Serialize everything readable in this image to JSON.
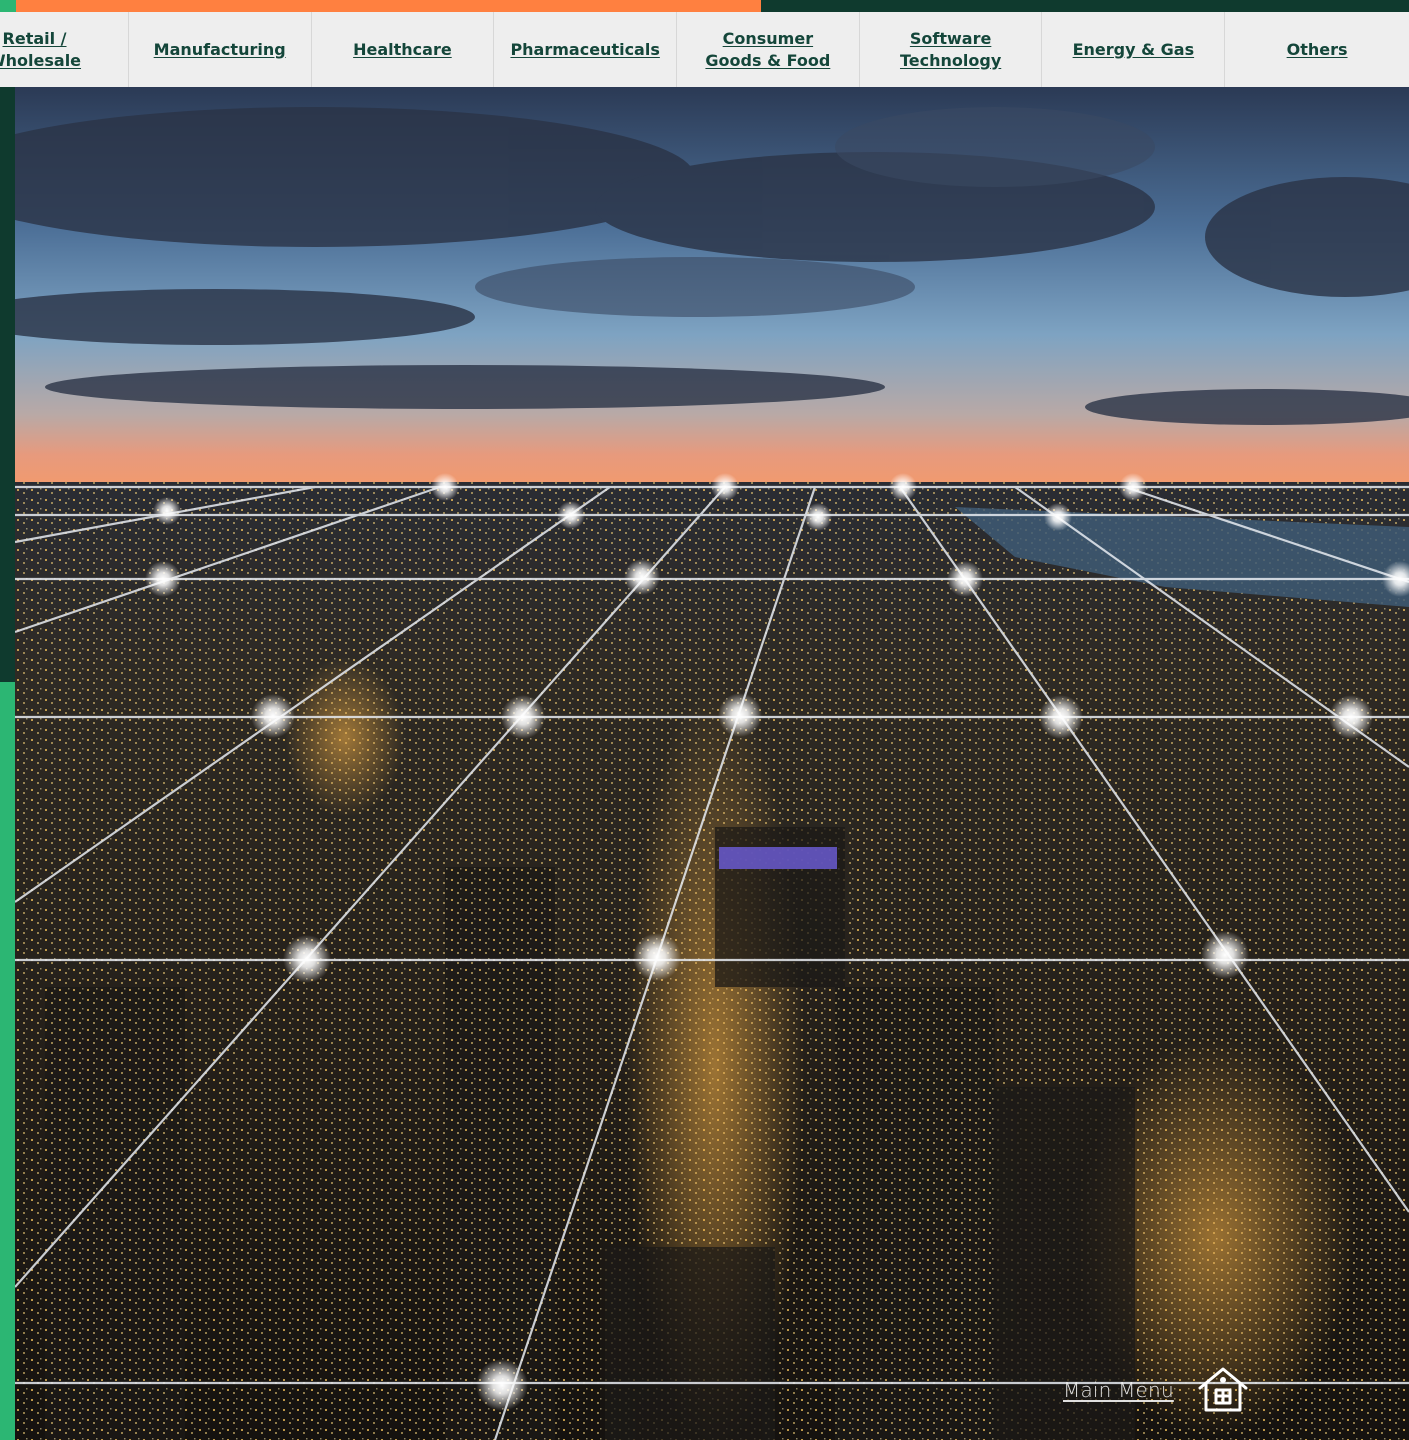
{
  "progress": {
    "fraction": 0.54,
    "accent_color": "#ff8040",
    "track_color": "#0f3a2e",
    "cap_color": "#2cb673"
  },
  "nav": {
    "tabs": [
      {
        "label": "Retail /\nWholesale"
      },
      {
        "label": "Manufacturing"
      },
      {
        "label": "Healthcare"
      },
      {
        "label": "Pharmaceuticals"
      },
      {
        "label": "Consumer\nGoods & Food"
      },
      {
        "label": "Software\nTechnology"
      },
      {
        "label": "Energy & Gas"
      },
      {
        "label": "Others"
      }
    ]
  },
  "hero": {
    "icon": "city-network-photo"
  },
  "footer": {
    "main_menu_label": "Main Menu",
    "home_icon": "home-icon"
  }
}
